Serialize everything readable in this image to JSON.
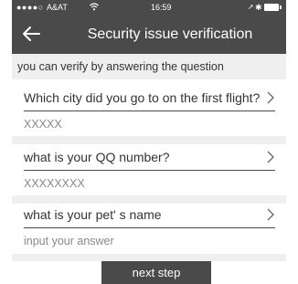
{
  "status_bar": {
    "signal": "●●●●○",
    "carrier": "A&AT",
    "time": "16:59",
    "bluetooth": "✱"
  },
  "nav": {
    "title": "Security issue verification"
  },
  "hint": "you can verify by answering the question",
  "questions": [
    {
      "label": "Which city did you go to on the first flight?",
      "answer": "XXXXX"
    },
    {
      "label": "what is your QQ number?",
      "answer": "XXXXXXXX"
    },
    {
      "label": "what is your pet' s name",
      "placeholder": "input your answer"
    }
  ],
  "next_button": "next step",
  "colors": {
    "bar": "#4a4a4a",
    "section_bg": "#efefef"
  }
}
